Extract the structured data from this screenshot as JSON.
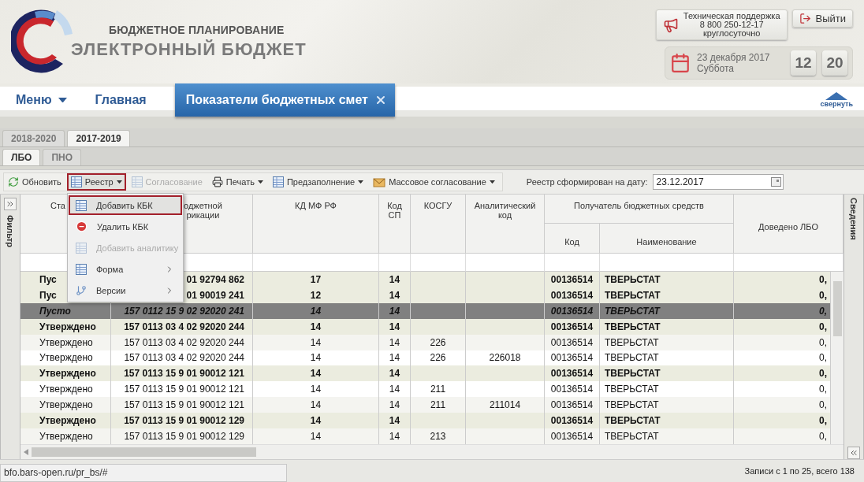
{
  "header": {
    "brand_subtitle": "БЮДЖЕТНОЕ ПЛАНИРОВАНИЕ",
    "brand_title": "ЭЛЕКТРОННЫЙ БЮДЖЕТ",
    "support": {
      "title": "Техническая поддержка",
      "phone": "8 800 250-12-17",
      "hours": "круглосуточно"
    },
    "logout": "Выйти",
    "date": "23 декабря 2017",
    "weekday": "Суббота",
    "hours": "12",
    "minutes": "20"
  },
  "nav": {
    "items": [
      {
        "label": "Меню",
        "kind": "dropdown",
        "selected": false
      },
      {
        "label": "Главная",
        "kind": "link",
        "selected": false
      },
      {
        "label": "Показатели бюджетных смет",
        "kind": "closable",
        "selected": true
      }
    ],
    "collapse": "свернуть"
  },
  "year_tabs": [
    {
      "label": "2018-2020",
      "selected": false
    },
    {
      "label": "2017-2019",
      "selected": true
    }
  ],
  "sub_tabs": [
    {
      "label": "ЛБО",
      "selected": true
    },
    {
      "label": "ПНО",
      "selected": false
    }
  ],
  "toolbar": {
    "buttons": [
      {
        "label": "Обновить",
        "dropdown": false,
        "disabled": false,
        "selected": false
      },
      {
        "label": "Реестр",
        "dropdown": true,
        "disabled": false,
        "selected": true
      },
      {
        "label": "Согласование",
        "dropdown": false,
        "disabled": true,
        "selected": false
      },
      {
        "label": "Печать",
        "dropdown": true,
        "disabled": false,
        "selected": false
      },
      {
        "label": "Предзаполнение",
        "dropdown": true,
        "disabled": false,
        "selected": false
      },
      {
        "label": "Массовое согласование",
        "dropdown": true,
        "disabled": false,
        "selected": false
      }
    ],
    "date_label": "Реестр сформирован на дату:",
    "date_value": "23.12.2017"
  },
  "menu": {
    "items": [
      {
        "label": "Добавить КБК",
        "selected": true,
        "disabled": false,
        "submenu": false
      },
      {
        "label": "Удалить КБК",
        "selected": false,
        "disabled": false,
        "submenu": false
      },
      {
        "label": "Добавить аналитику",
        "selected": false,
        "disabled": true,
        "submenu": false
      },
      {
        "label": "Форма",
        "selected": false,
        "disabled": false,
        "submenu": true
      },
      {
        "label": "Версии",
        "selected": false,
        "disabled": false,
        "submenu": true
      }
    ]
  },
  "side_panels": {
    "left": "Фильтр",
    "right": "Сведения"
  },
  "table": {
    "columns": [
      {
        "label": "Ста"
      },
      {
        "label": "оджетной\nрикации"
      },
      {
        "label": "КД МФ РФ"
      },
      {
        "label": "Код СП"
      },
      {
        "label": "КОСГУ"
      },
      {
        "label": "Аналитический код"
      },
      {
        "label": "Получатель бюджетных средств",
        "children": [
          {
            "label": "Код"
          },
          {
            "label": "Наименование"
          }
        ]
      },
      {
        "label": "Доведено ЛБО"
      }
    ],
    "rows": [
      {
        "kind": "group",
        "selected": false,
        "cells": [
          "Пус",
          "01 92794 862",
          "17",
          "14",
          null,
          null,
          "00136514",
          "ТВЕРЬСТАТ",
          "0,"
        ]
      },
      {
        "kind": "group",
        "selected": false,
        "cells": [
          "Пус",
          "01 90019 241",
          "12",
          "14",
          null,
          null,
          "00136514",
          "ТВЕРЬСТАТ",
          "0,"
        ]
      },
      {
        "kind": "group",
        "selected": true,
        "cells": [
          "Пусто",
          "157 0112 15 9 02 92020 241",
          "14",
          "14",
          null,
          null,
          "00136514",
          "ТВЕРЬСТАТ",
          "0,"
        ]
      },
      {
        "kind": "group",
        "selected": false,
        "cells": [
          "Утверждено",
          "157 0113 03 4 02 92020 244",
          "14",
          "14",
          null,
          null,
          "00136514",
          "ТВЕРЬСТАТ",
          "0,"
        ]
      },
      {
        "kind": "item",
        "selected": false,
        "cells": [
          "Утверждено",
          "157 0113 03 4 02 92020 244",
          "14",
          "14",
          "226",
          null,
          "00136514",
          "ТВЕРЬСТАТ",
          "0,"
        ]
      },
      {
        "kind": "item",
        "selected": false,
        "cells": [
          "Утверждено",
          "157 0113 03 4 02 92020 244",
          "14",
          "14",
          "226",
          "226018",
          "00136514",
          "ТВЕРЬСТАТ",
          "0,"
        ]
      },
      {
        "kind": "group",
        "selected": false,
        "cells": [
          "Утверждено",
          "157 0113 15 9 01 90012 121",
          "14",
          "14",
          null,
          null,
          "00136514",
          "ТВЕРЬСТАТ",
          "0,"
        ]
      },
      {
        "kind": "item",
        "selected": false,
        "cells": [
          "Утверждено",
          "157 0113 15 9 01 90012 121",
          "14",
          "14",
          "211",
          null,
          "00136514",
          "ТВЕРЬСТАТ",
          "0,"
        ]
      },
      {
        "kind": "item",
        "selected": false,
        "cells": [
          "Утверждено",
          "157 0113 15 9 01 90012 121",
          "14",
          "14",
          "211",
          "211014",
          "00136514",
          "ТВЕРЬСТАТ",
          "0,"
        ]
      },
      {
        "kind": "group",
        "selected": false,
        "cells": [
          "Утверждено",
          "157 0113 15 9 01 90012 129",
          "14",
          "14",
          null,
          null,
          "00136514",
          "ТВЕРЬСТАТ",
          "0,"
        ]
      },
      {
        "kind": "item",
        "selected": false,
        "cells": [
          "Утверждено",
          "157 0113 15 9 01 90012 129",
          "14",
          "14",
          "213",
          null,
          "00136514",
          "ТВЕРЬСТАТ",
          "0,"
        ]
      }
    ]
  },
  "status_bar": {
    "records": "Записи с 1 по 25, всего 138",
    "url": "bfo.bars-open.ru/pr_bs/#"
  }
}
